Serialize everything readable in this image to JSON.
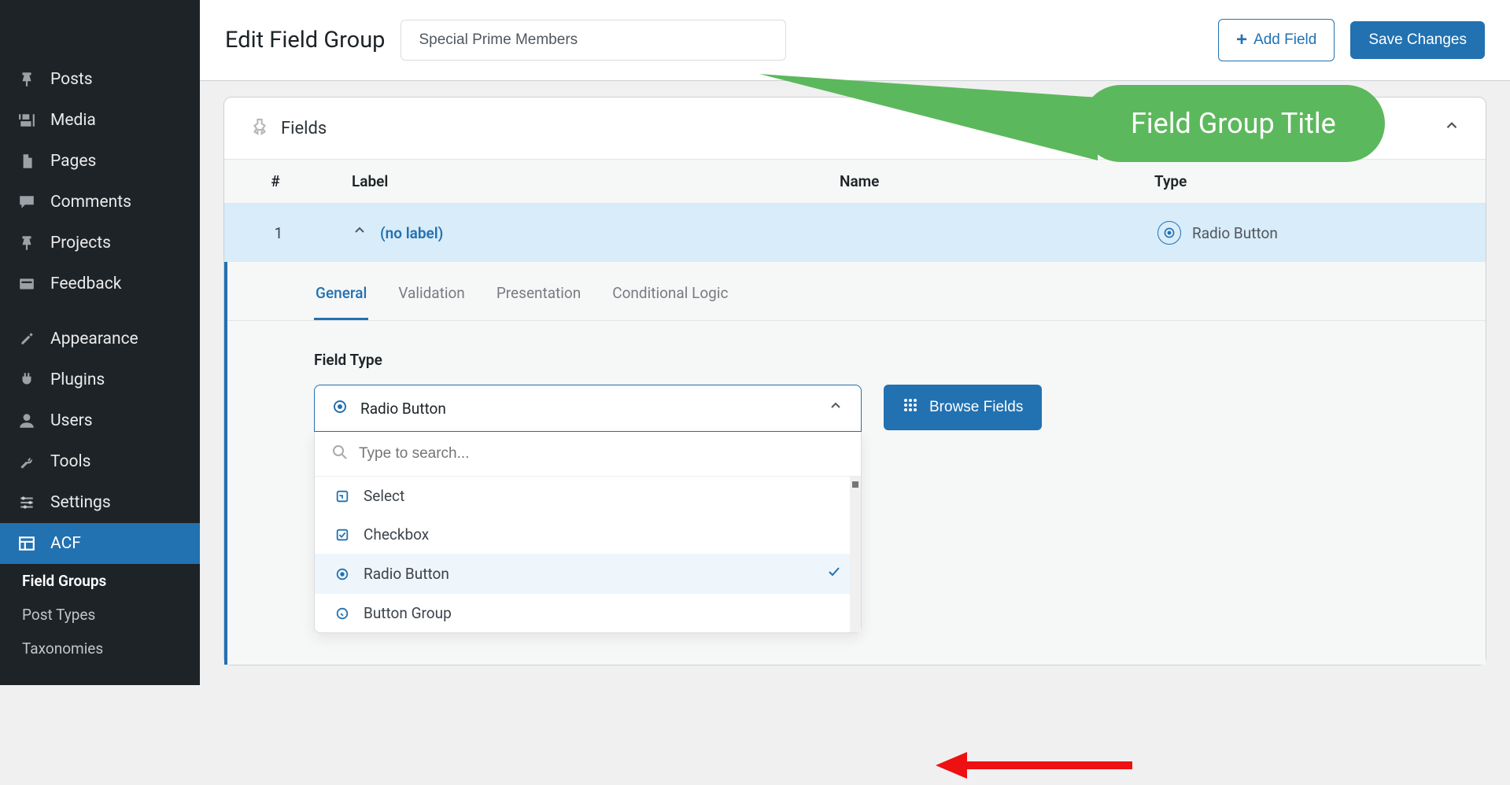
{
  "sidebar": {
    "items": [
      {
        "label": "Posts",
        "icon": "pin"
      },
      {
        "label": "Media",
        "icon": "media"
      },
      {
        "label": "Pages",
        "icon": "page"
      },
      {
        "label": "Comments",
        "icon": "comment"
      },
      {
        "label": "Projects",
        "icon": "pin"
      },
      {
        "label": "Feedback",
        "icon": "feedback"
      },
      {
        "label": "Appearance",
        "icon": "brush"
      },
      {
        "label": "Plugins",
        "icon": "plug"
      },
      {
        "label": "Users",
        "icon": "user"
      },
      {
        "label": "Tools",
        "icon": "wrench"
      },
      {
        "label": "Settings",
        "icon": "sliders"
      },
      {
        "label": "ACF",
        "icon": "layout"
      }
    ],
    "subitems": [
      {
        "label": "Field Groups",
        "active": true
      },
      {
        "label": "Post Types",
        "active": false
      },
      {
        "label": "Taxonomies",
        "active": false
      }
    ]
  },
  "header": {
    "title": "Edit Field Group",
    "group_title_value": "Special Prime Members",
    "add_field_label": "Add Field",
    "save_label": "Save Changes"
  },
  "panel": {
    "title": "Fields",
    "columns": {
      "num": "#",
      "label": "Label",
      "name": "Name",
      "type": "Type"
    }
  },
  "row": {
    "index": "1",
    "label": "(no label)",
    "name": "",
    "type": "Radio Button"
  },
  "tabs": [
    "General",
    "Validation",
    "Presentation",
    "Conditional Logic"
  ],
  "field_type": {
    "label": "Field Type",
    "selected": "Radio Button",
    "search_placeholder": "Type to search...",
    "options": [
      {
        "label": "Select"
      },
      {
        "label": "Checkbox"
      },
      {
        "label": "Radio Button",
        "selected": true
      },
      {
        "label": "Button Group"
      }
    ],
    "browse_label": "Browse Fields"
  },
  "annotations": {
    "callout_text": "Field Group Title"
  },
  "colors": {
    "accent": "#2271b1",
    "green": "#5cb85c",
    "red": "#e11"
  }
}
